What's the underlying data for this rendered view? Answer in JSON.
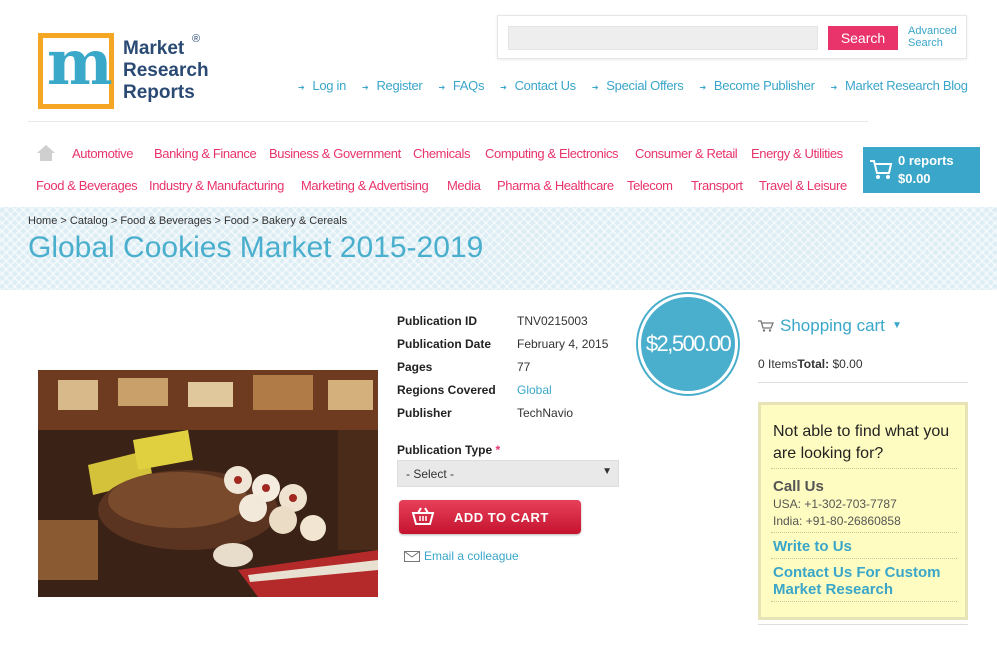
{
  "logo": {
    "letter": "m",
    "line1": "Market",
    "line2": "Research",
    "line3": "Reports",
    "reg": "®"
  },
  "search": {
    "placeholder": "",
    "button_label": "Search",
    "advanced_line1": "Advanced",
    "advanced_line2": "Search"
  },
  "toplinks": [
    "Log in",
    "Register",
    "FAQs",
    "Contact Us",
    "Special Offers",
    "Become Publisher",
    "Market Research Blog"
  ],
  "nav": {
    "row1": [
      "Automotive",
      "Banking & Finance",
      "Business & Government",
      "Chemicals",
      "Computing & Electronics",
      "Consumer & Retail",
      "Energy & Utilities"
    ],
    "row2": [
      "Food & Beverages",
      "Industry & Manufacturing",
      "Marketing & Advertising",
      "Media",
      "Pharma & Healthcare",
      "Telecom",
      "Transport",
      "Travel & Leisure"
    ]
  },
  "cart": {
    "reports": "0 reports",
    "total": "$0.00"
  },
  "breadcrumb": "Home > Catalog > Food & Beverages > Food > Bakery & Cereals",
  "title": "Global Cookies Market 2015-2019",
  "product": {
    "info": [
      {
        "label": "Publication ID",
        "value": "TNV0215003"
      },
      {
        "label": "Publication Date",
        "value": "February 4, 2015"
      },
      {
        "label": "Pages",
        "value": "77"
      },
      {
        "label": "Regions Covered",
        "value": "Global"
      },
      {
        "label": "Publisher",
        "value": "TechNavio"
      }
    ],
    "price": "$2,500.00",
    "pub_type_label": "Publication Type",
    "required_mark": "*",
    "select_value": "- Select -",
    "add_to_cart": "ADD TO CART",
    "email_colleague": "Email a colleague"
  },
  "sidebar": {
    "cart_title": "Shopping cart",
    "items_label": "0 Items",
    "total_label": "Total:",
    "total_value": "$0.00",
    "help_title": "Not able to find what you are looking for?",
    "call_us": "Call Us",
    "phone_usa": "USA: +1-302-703-7787",
    "phone_india": "India: +91-80-26860858",
    "write_to_us": "Write to Us",
    "custom_research": "Contact Us For Custom Market Research"
  },
  "colors": {
    "accent_pink": "#e8336b",
    "accent_blue": "#3aa6c9",
    "help_bg": "#fefcc0"
  }
}
